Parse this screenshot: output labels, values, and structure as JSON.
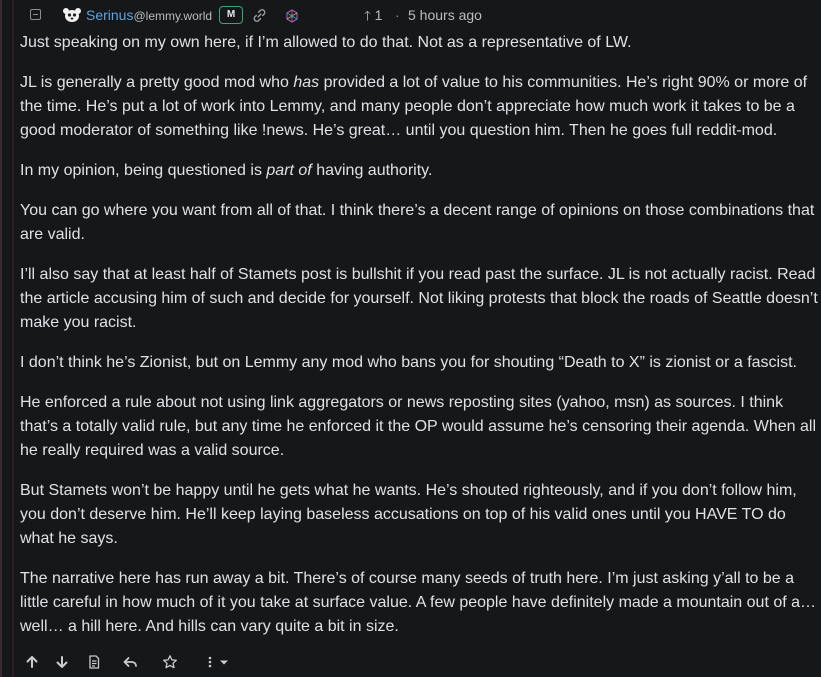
{
  "comment": {
    "user": {
      "name": "Serinus",
      "instance": "@lemmy.world",
      "mod_badge": "M"
    },
    "score": {
      "arrow": "🡑",
      "value": "1"
    },
    "separator": "·",
    "timestamp": "5 hours ago",
    "paragraphs": [
      {
        "segments": [
          {
            "text": "Just speaking on my own here, if I’m allowed to do that. Not as a representative of LW."
          }
        ]
      },
      {
        "segments": [
          {
            "text": "JL is generally a pretty good mod who "
          },
          {
            "text": "has",
            "em": true
          },
          {
            "text": " provided a lot of value to his communities. He’s right 90% or more of the time. He’s put a lot of work into Lemmy, and many people don’t appreciate how much work it takes to be a good moderator of something like !news. He’s great… until you question him. Then he goes full reddit-mod."
          }
        ]
      },
      {
        "segments": [
          {
            "text": "In my opinion, being questioned is "
          },
          {
            "text": "part of",
            "em": true
          },
          {
            "text": " having authority."
          }
        ]
      },
      {
        "segments": [
          {
            "text": "You can go where you want from all of that. I think there’s a decent range of opinions on those combinations that are valid."
          }
        ]
      },
      {
        "segments": [
          {
            "text": "I’ll also say that at least half of Stamets post is bullshit if you read past the surface. JL is not actually racist. Read the article accusing him of such and decide for yourself. Not liking protests that block the roads of Seattle doesn’t make you racist."
          }
        ]
      },
      {
        "segments": [
          {
            "text": "I don’t think he’s Zionist, but on Lemmy any mod who bans you for shouting “Death to X” is zionist or a fascist."
          }
        ]
      },
      {
        "segments": [
          {
            "text": "He enforced a rule about not using link aggregators or news reposting sites (yahoo, msn) as sources. I think that’s a totally valid rule, but any time he enforced it the OP would assume he’s censoring their agenda. When all he really required was a valid source."
          }
        ]
      },
      {
        "segments": [
          {
            "text": "But Stamets won’t be happy until he gets what he wants. He’s shouted righteously, and if you don’t follow him, you don’t deserve him. He’ll keep laying baseless accusations on top of his valid ones until you HAVE TO do what he says."
          }
        ]
      },
      {
        "segments": [
          {
            "text": "The narrative here has run away a bit. There’s of course many seeds of truth here. I’m just asking y’all to be a little careful in how much of it you take at surface value. A few people have definitely made a mountain out of a… well… a hill here. And hills can vary quite a bit in size."
          }
        ]
      }
    ],
    "actions": [
      {
        "name": "upvote-icon"
      },
      {
        "name": "downvote-icon"
      },
      {
        "name": "view-source-icon"
      },
      {
        "name": "reply-icon"
      },
      {
        "name": "star-icon"
      },
      {
        "name": "more-options-icon"
      }
    ]
  },
  "colors": {
    "background": "#161718",
    "text": "#dee2e6",
    "username": "#5aa4e8",
    "mod_badge_border": "#3aa57a",
    "muted": "#b8bdc2"
  }
}
